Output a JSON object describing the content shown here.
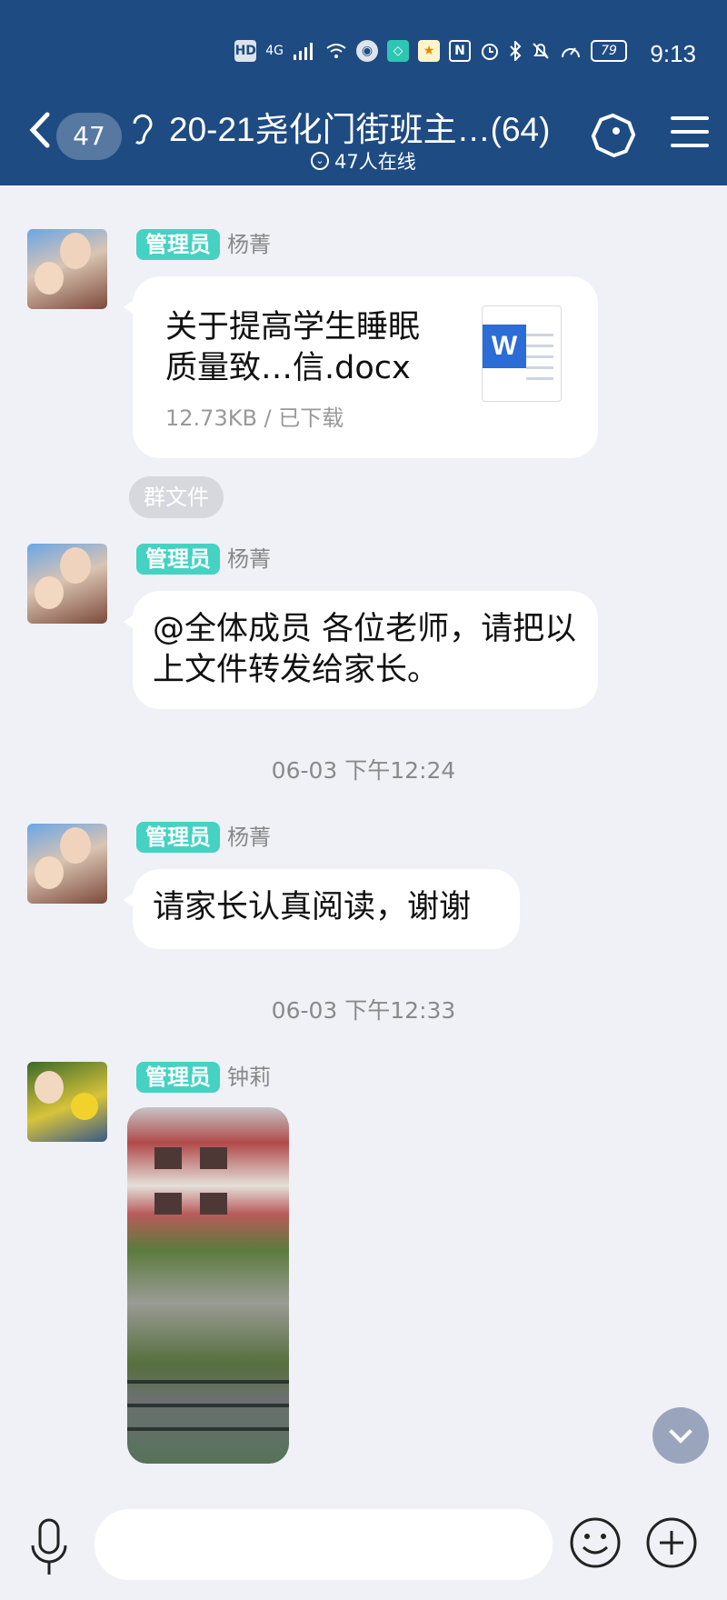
{
  "status_bar": {
    "time": "9:13",
    "battery": "79",
    "network": "4G",
    "icons": [
      "hd-icon",
      "signal-icon",
      "wifi-icon",
      "app-icon",
      "app-icon",
      "app-icon",
      "nfc-icon",
      "alarm-icon",
      "bluetooth-icon",
      "mute-icon",
      "speed-icon",
      "battery-icon"
    ]
  },
  "header": {
    "unread_count": "47",
    "group_title": "20-21尧化门街班主…(64)",
    "online_status": "47人在线"
  },
  "messages": [
    {
      "role": "管理员",
      "sender": "杨菁",
      "type": "file",
      "file_name": "关于提高学生睡眠质量致…信.docx",
      "file_meta": "12.73KB / 已下载",
      "file_tag": "群文件"
    },
    {
      "role": "管理员",
      "sender": "杨菁",
      "type": "text",
      "text": "@全体成员 各位老师，请把以上文件转发给家长。"
    },
    {
      "timestamp": "06-03 下午12:24"
    },
    {
      "role": "管理员",
      "sender": "杨菁",
      "type": "text",
      "text": "请家长认真阅读，谢谢"
    },
    {
      "timestamp": "06-03 下午12:33"
    },
    {
      "role": "管理员",
      "sender": "钟莉",
      "type": "image"
    }
  ],
  "input_bar": {
    "placeholder": ""
  },
  "colors": {
    "header_bg": "#1e4b82",
    "role_badge": "#45d2c3",
    "page_bg": "#eff1f6"
  }
}
